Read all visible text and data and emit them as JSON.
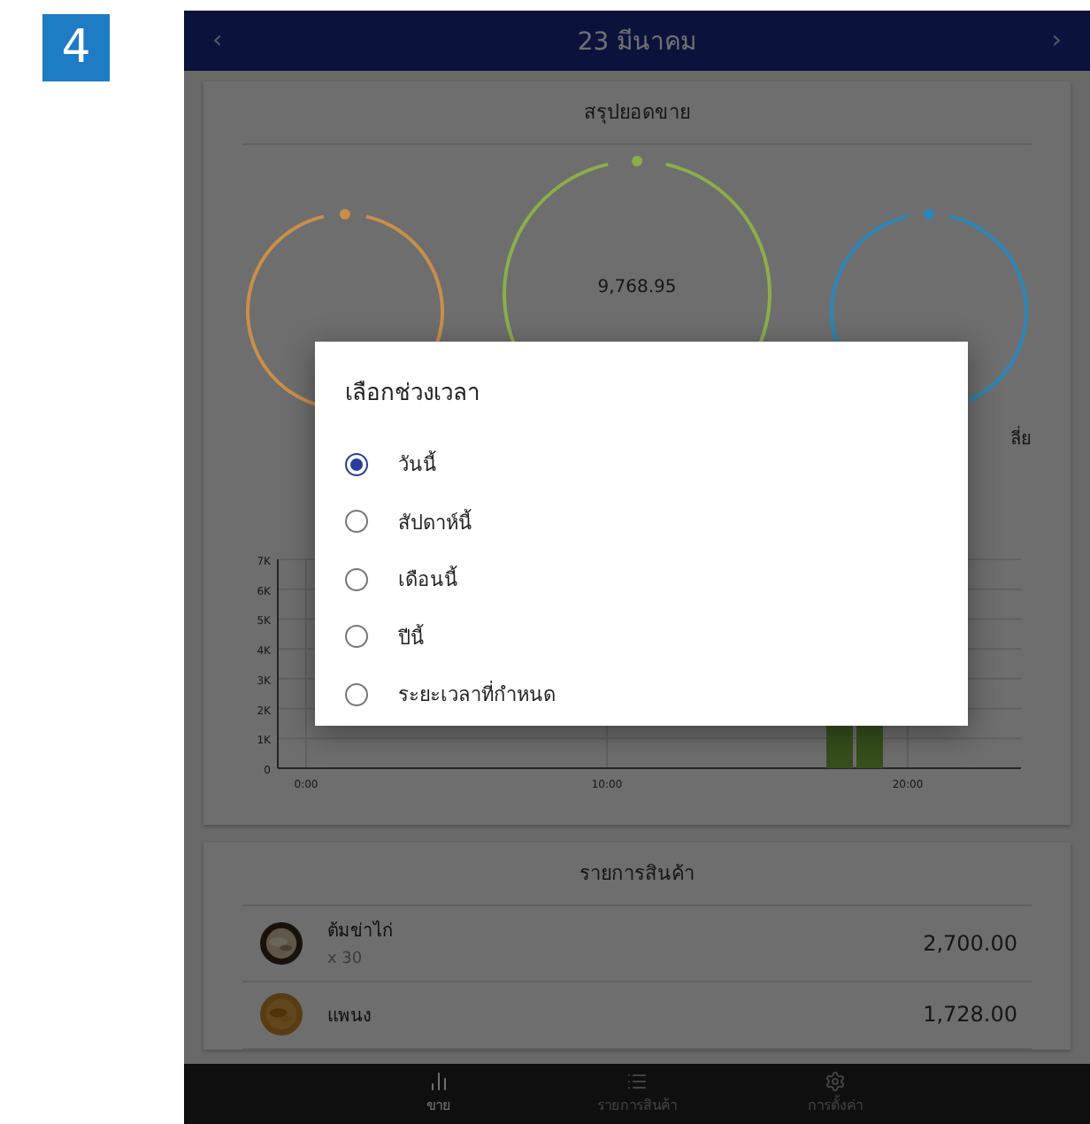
{
  "step_badge": "4",
  "header": {
    "title": "23 มีนาคม",
    "prev": "‹",
    "next": "›"
  },
  "summary_card": {
    "title": "สรุปยอดขาย",
    "gauges": [
      {
        "color": "#c98f4a"
      },
      {
        "color": "#8bae4a",
        "value": "9,768.95"
      },
      {
        "color": "#2a86b8",
        "label": "ลี่ย"
      }
    ],
    "chart_axis": {
      "y_labels": [
        "7K",
        "6K",
        "5K",
        "4K",
        "3K",
        "2K",
        "1K",
        "0"
      ],
      "x_labels": [
        "0:00",
        "10:00",
        "20:00"
      ]
    }
  },
  "products_card": {
    "title": "รายการสินค้า",
    "items": [
      {
        "name": "ต้มข่าไก่",
        "quantity": "x 30",
        "price": "2,700.00"
      },
      {
        "name": "แพนง",
        "price": "1,728.00"
      }
    ]
  },
  "bottom_nav": [
    {
      "label": "ขาย",
      "selected": true
    },
    {
      "label": "รายการสินค้า",
      "selected": false
    },
    {
      "label": "การตั้งค่า",
      "selected": false
    }
  ],
  "dialog": {
    "title": "เลือกช่วงเวลา",
    "options": [
      {
        "label": "วันนี้",
        "selected": true
      },
      {
        "label": "สัปดาห์นี้",
        "selected": false
      },
      {
        "label": "เดือนนี้",
        "selected": false
      },
      {
        "label": "ปีนี้",
        "selected": false
      },
      {
        "label": "ระยะเวลาที่กำหนด",
        "selected": false
      }
    ]
  }
}
